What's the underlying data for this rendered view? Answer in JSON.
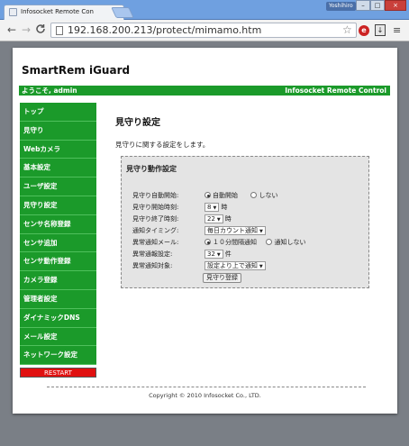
{
  "browser": {
    "tab_title": "Infosocket Remote Con",
    "tab_close": "×",
    "user_label": "Yoshihiro",
    "minimize": "–",
    "maximize": "□",
    "close": "×",
    "back": "←",
    "forward": "→",
    "reload": "C",
    "url": "192.168.200.213/protect/mimamo.htm",
    "star": "☆",
    "ext_icon": "e",
    "download_icon": "↓",
    "menu_icon": "≡"
  },
  "header": {
    "site_title": "SmartRem iGuard",
    "welcome": "ようこそ, admin",
    "brand": "Infosocket Remote Control"
  },
  "sidebar": {
    "items": [
      {
        "label": "トップ"
      },
      {
        "label": "見守り"
      },
      {
        "label": "Webカメラ"
      },
      {
        "label": "基本設定"
      },
      {
        "label": "ユーザ設定"
      },
      {
        "label": "見守り設定"
      },
      {
        "label": "センサ名称登録"
      },
      {
        "label": "センサ追加"
      },
      {
        "label": "センサ動作登録"
      },
      {
        "label": "カメラ登録"
      },
      {
        "label": "管理者設定"
      },
      {
        "label": "ダイナミックDNS"
      },
      {
        "label": "メール設定"
      },
      {
        "label": "ネットワーク設定"
      }
    ],
    "restart": "RESTART"
  },
  "main": {
    "title": "見守り設定",
    "description": "見守りに関する設定をします。",
    "panel_title": "見守り動作設定",
    "fields": {
      "auto_start": {
        "label": "見守り自動開始:",
        "opt_on": "自動開始",
        "opt_off": "しない"
      },
      "start_time": {
        "label": "見守り開始時刻:",
        "value": "8",
        "unit": "時"
      },
      "end_time": {
        "label": "見守り終了時刻:",
        "value": "22",
        "unit": "時"
      },
      "notify_timing": {
        "label": "通知タイミング:",
        "value": "毎日カウント通知"
      },
      "abnormal_mail": {
        "label": "異常通知メール:",
        "opt_a": "１０分間隔通知",
        "opt_b": "通知しない"
      },
      "abnormal_level": {
        "label": "異常通報設定:",
        "value": "32",
        "unit": "件"
      },
      "abnormal_report": {
        "label": "異常通知対象:",
        "value": "設定より上で通知"
      }
    },
    "submit": "見守り登録"
  },
  "footer": {
    "copyright": "Copyright © 2010 Infosocket Co., LTD."
  }
}
